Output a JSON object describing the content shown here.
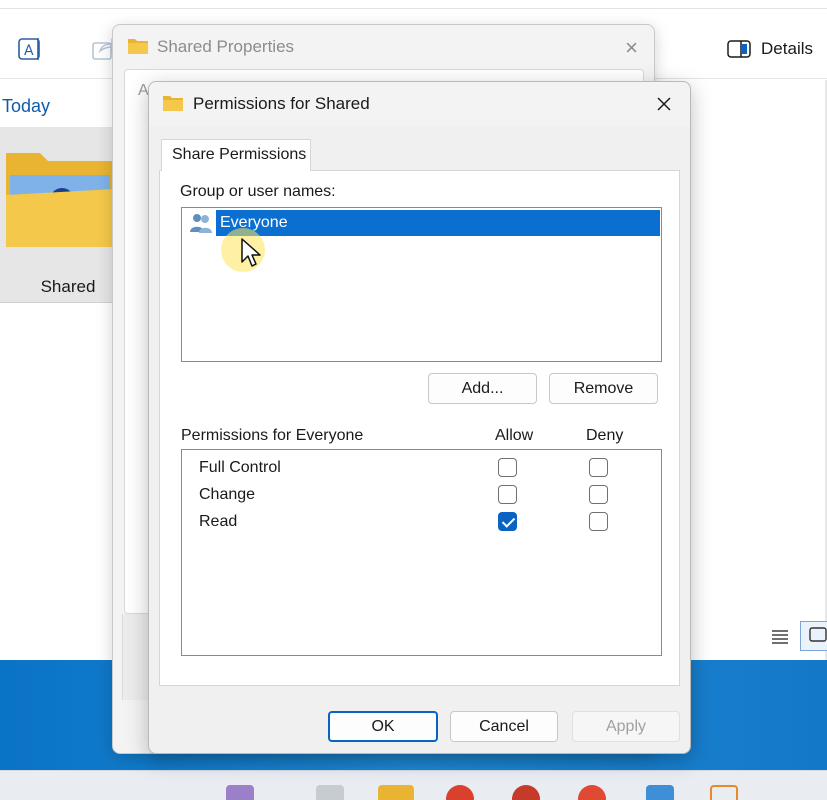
{
  "explorer": {
    "details_label": "Details",
    "group_today": "Today",
    "folder_name": "Shared"
  },
  "properties_dialog": {
    "title": "Shared Properties",
    "tab_partial": "A",
    "close_glyph": "×"
  },
  "permissions_dialog": {
    "title": "Permissions for Shared",
    "tab": "Share Permissions",
    "group_label": "Group or user names:",
    "users": [
      {
        "name": "Everyone",
        "selected": true
      }
    ],
    "add_button": "Add...",
    "remove_button": "Remove",
    "permissions_label": "Permissions for Everyone",
    "allow_header": "Allow",
    "deny_header": "Deny",
    "permissions": [
      {
        "name": "Full Control",
        "allow": false,
        "deny": false
      },
      {
        "name": "Change",
        "allow": false,
        "deny": false
      },
      {
        "name": "Read",
        "allow": true,
        "deny": false
      }
    ],
    "ok_button": "OK",
    "cancel_button": "Cancel",
    "apply_button": "Apply"
  },
  "colors": {
    "accent": "#0a62c1",
    "selection": "#0a6fd0",
    "folder": "#f4c84a",
    "desktop_band": "#1478c8"
  }
}
